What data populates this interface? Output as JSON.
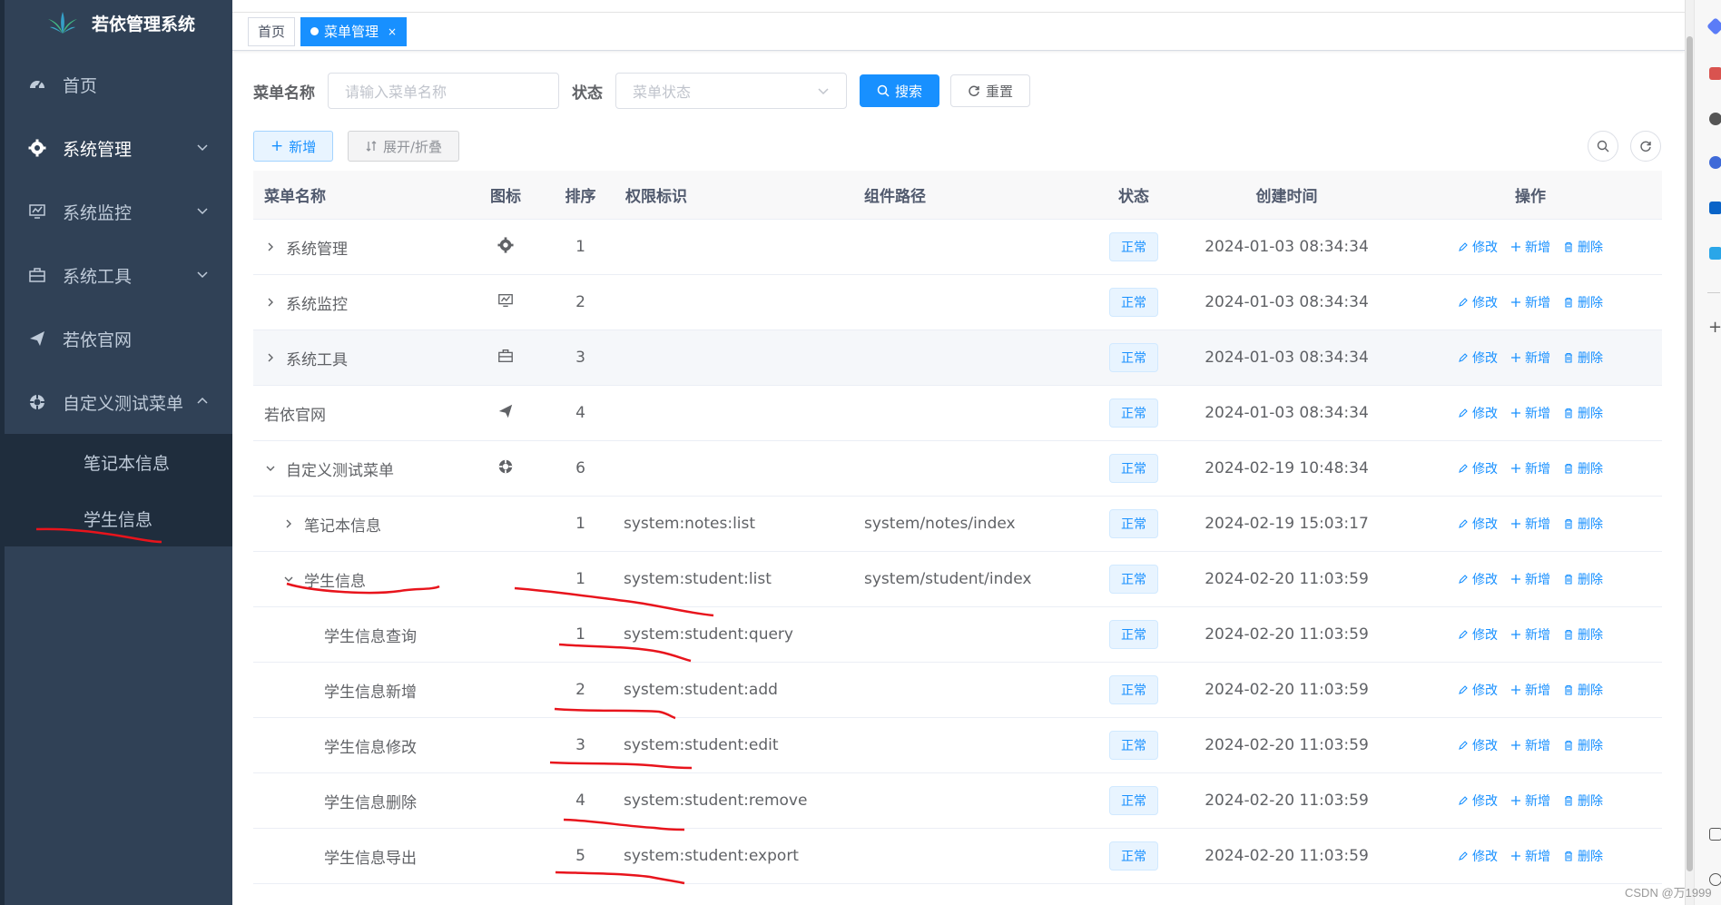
{
  "app": {
    "title": "若依管理系统"
  },
  "sidebar": {
    "items": [
      {
        "label": "首页",
        "icon": "dashboard-icon"
      },
      {
        "label": "系统管理",
        "icon": "gear-icon"
      },
      {
        "label": "系统监控",
        "icon": "monitor-icon"
      },
      {
        "label": "系统工具",
        "icon": "toolbox-icon"
      },
      {
        "label": "若依官网",
        "icon": "paper-plane-icon"
      },
      {
        "label": "自定义测试菜单",
        "icon": "gear-wheel-icon"
      }
    ],
    "submenu": [
      {
        "label": "笔记本信息"
      },
      {
        "label": "学生信息"
      }
    ]
  },
  "tags": {
    "home": "首页",
    "active": "菜单管理",
    "close": "×"
  },
  "search": {
    "name_label": "菜单名称",
    "name_placeholder": "请输入菜单名称",
    "status_label": "状态",
    "status_placeholder": "菜单状态",
    "search_button": "搜索",
    "reset_button": "重置"
  },
  "toolbar": {
    "add_button": "新增",
    "expand_button": "展开/折叠"
  },
  "table": {
    "headers": {
      "name": "菜单名称",
      "icon": "图标",
      "sort": "排序",
      "perm": "权限标识",
      "path": "组件路径",
      "status": "状态",
      "time": "创建时间",
      "ops": "操作"
    },
    "ops": {
      "edit": "修改",
      "add": "新增",
      "delete": "删除"
    },
    "rows": [
      {
        "name": "系统管理",
        "sort": "1",
        "perm": "",
        "path": "",
        "status": "正常",
        "time": "2024-01-03 08:34:34"
      },
      {
        "name": "系统监控",
        "sort": "2",
        "perm": "",
        "path": "",
        "status": "正常",
        "time": "2024-01-03 08:34:34"
      },
      {
        "name": "系统工具",
        "sort": "3",
        "perm": "",
        "path": "",
        "status": "正常",
        "time": "2024-01-03 08:34:34"
      },
      {
        "name": "若依官网",
        "sort": "4",
        "perm": "",
        "path": "",
        "status": "正常",
        "time": "2024-01-03 08:34:34"
      },
      {
        "name": "自定义测试菜单",
        "sort": "6",
        "perm": "",
        "path": "",
        "status": "正常",
        "time": "2024-02-19 10:48:34"
      },
      {
        "name": "笔记本信息",
        "sort": "1",
        "perm": "system:notes:list",
        "path": "system/notes/index",
        "status": "正常",
        "time": "2024-02-19 15:03:17"
      },
      {
        "name": "学生信息",
        "sort": "1",
        "perm": "system:student:list",
        "path": "system/student/index",
        "status": "正常",
        "time": "2024-02-20 11:03:59"
      },
      {
        "name": "学生信息查询",
        "sort": "1",
        "perm": "system:student:query",
        "path": "",
        "status": "正常",
        "time": "2024-02-20 11:03:59"
      },
      {
        "name": "学生信息新增",
        "sort": "2",
        "perm": "system:student:add",
        "path": "",
        "status": "正常",
        "time": "2024-02-20 11:03:59"
      },
      {
        "name": "学生信息修改",
        "sort": "3",
        "perm": "system:student:edit",
        "path": "",
        "status": "正常",
        "time": "2024-02-20 11:03:59"
      },
      {
        "name": "学生信息删除",
        "sort": "4",
        "perm": "system:student:remove",
        "path": "",
        "status": "正常",
        "time": "2024-02-20 11:03:59"
      },
      {
        "name": "学生信息导出",
        "sort": "5",
        "perm": "system:student:export",
        "path": "",
        "status": "正常",
        "time": "2024-02-20 11:03:59"
      }
    ]
  },
  "watermark": "CSDN @万1999",
  "colors": {
    "sidebar_bg": "#304156",
    "primary": "#1890ff",
    "annotation_red": "#e8141c"
  }
}
